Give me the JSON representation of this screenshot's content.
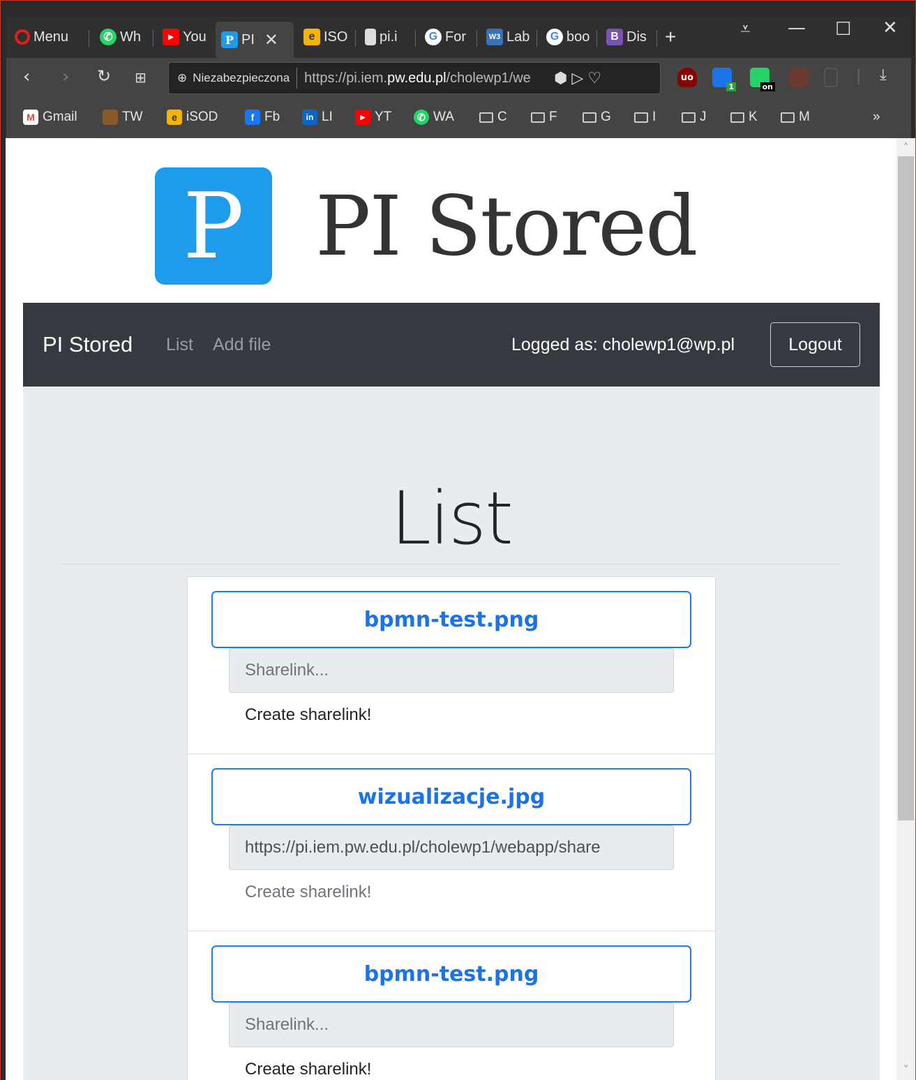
{
  "browser": {
    "tabs": [
      {
        "label": "Menu",
        "icon": "opera-icon",
        "color": "#e0201a"
      },
      {
        "label": "Wh",
        "icon": "whatsapp-icon",
        "color": "#25d366"
      },
      {
        "label": "You",
        "icon": "youtube-icon",
        "color": "#ff0000"
      },
      {
        "label": "PI",
        "icon": "pi-icon",
        "color": "#1e9bea",
        "active": true
      },
      {
        "label": "ISO",
        "icon": "isod-icon",
        "color": "#f5b400"
      },
      {
        "label": "pi.i",
        "icon": "file-icon",
        "color": "#dddddd"
      },
      {
        "label": "For",
        "icon": "google-icon",
        "color": "#4285f4"
      },
      {
        "label": "Lab",
        "icon": "w3schools-icon",
        "color": "#3b6fb6"
      },
      {
        "label": "boo",
        "icon": "google-icon",
        "color": "#4285f4"
      },
      {
        "label": "Dis",
        "icon": "bootstrap-icon",
        "color": "#7952b3"
      }
    ],
    "address": {
      "security_label": "Niezabezpieczona",
      "url_prefix": "https://pi.iem.",
      "url_domain": "pw.edu.pl",
      "url_suffix": "/cholewp1/we"
    },
    "extensions": {
      "badge_1": "1",
      "badge_on": "on"
    },
    "bookmarks": [
      {
        "label": "Gmail",
        "icon": "gmail-icon",
        "color": "#ea4335"
      },
      {
        "label": "TW",
        "icon": "tw-icon",
        "color": "#8b5a2b"
      },
      {
        "label": "iSOD",
        "icon": "isod-icon",
        "color": "#f5b400"
      },
      {
        "label": "Fb",
        "icon": "facebook-icon",
        "color": "#1877f2"
      },
      {
        "label": "LI",
        "icon": "linkedin-icon",
        "color": "#0a66c2"
      },
      {
        "label": "YT",
        "icon": "youtube-icon",
        "color": "#ff0000"
      },
      {
        "label": "WA",
        "icon": "whatsapp-icon",
        "color": "#25d366"
      },
      {
        "label": "C",
        "icon": "folder-icon"
      },
      {
        "label": "F",
        "icon": "folder-icon"
      },
      {
        "label": "G",
        "icon": "folder-icon"
      },
      {
        "label": "I",
        "icon": "folder-icon"
      },
      {
        "label": "J",
        "icon": "folder-icon"
      },
      {
        "label": "K",
        "icon": "folder-icon"
      },
      {
        "label": "M",
        "icon": "folder-icon"
      }
    ],
    "bookmarks_more": "»"
  },
  "header": {
    "logo_letter": "P",
    "title": "PI Stored",
    "accent_color": "#1e9bea"
  },
  "navbar": {
    "brand": "PI Stored",
    "links": [
      "List",
      "Add file"
    ],
    "user_text": "Logged as: cholewp1@wp.pl",
    "logout_label": "Logout"
  },
  "main": {
    "title": "List",
    "files": [
      {
        "name": "bpmn-test.png",
        "sharelink_value": "",
        "sharelink_placeholder": "Sharelink...",
        "action_label": "Create sharelink!",
        "action_muted": false
      },
      {
        "name": "wizualizacje.jpg",
        "sharelink_value": "https://pi.iem.pw.edu.pl/cholewp1/webapp/share",
        "sharelink_placeholder": "Sharelink...",
        "action_label": "Create sharelink!",
        "action_muted": true
      },
      {
        "name": "bpmn-test.png",
        "sharelink_value": "",
        "sharelink_placeholder": "Sharelink...",
        "action_label": "Create sharelink!",
        "action_muted": false
      }
    ]
  }
}
